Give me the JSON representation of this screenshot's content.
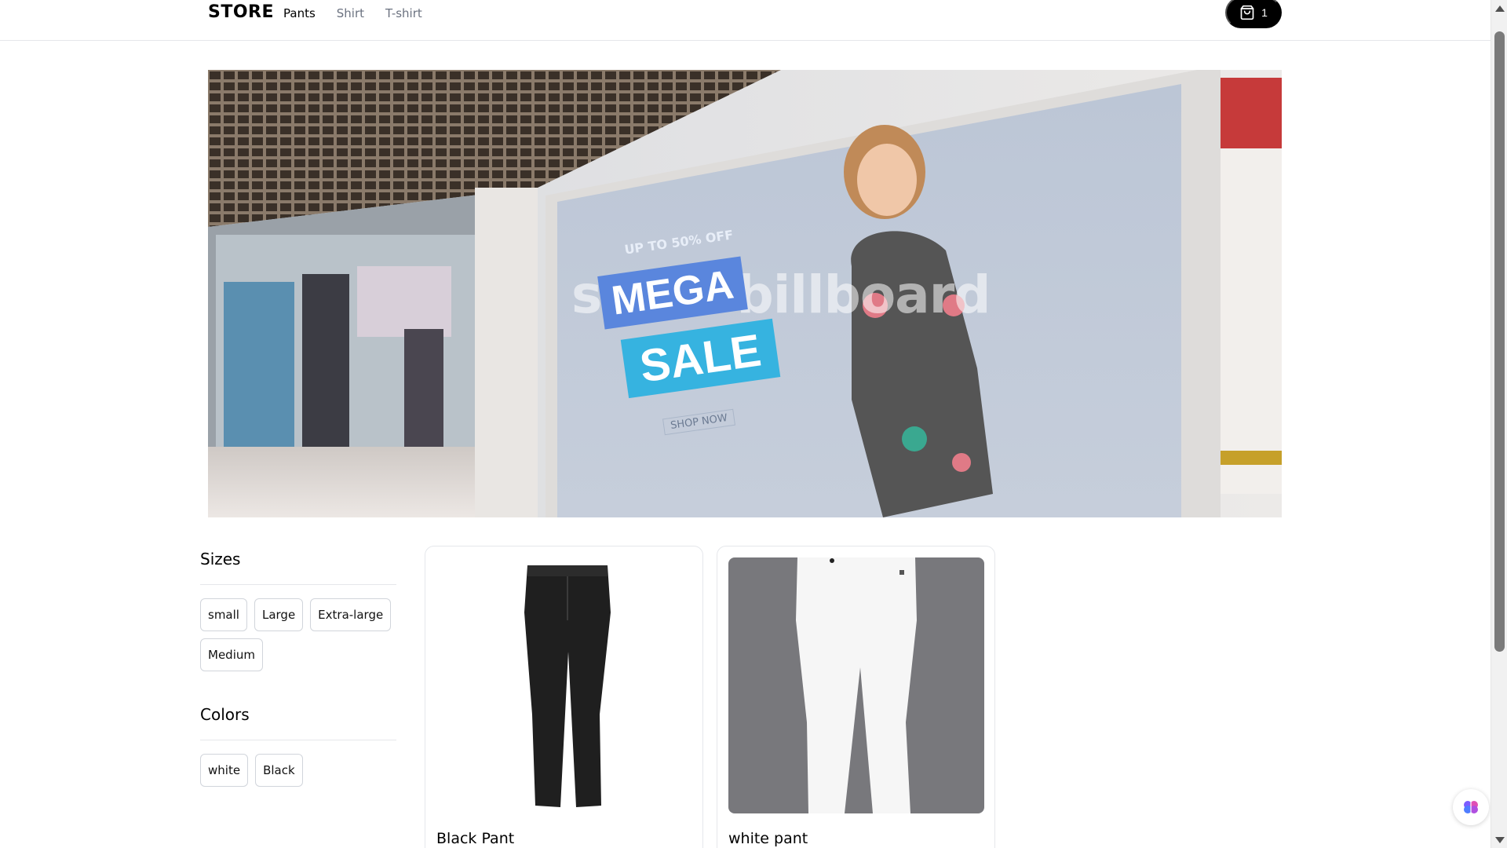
{
  "header": {
    "brand": "STORE",
    "nav": [
      {
        "label": "Pants",
        "active": true
      },
      {
        "label": "Shirt",
        "active": false
      },
      {
        "label": "T-shirt",
        "active": false
      }
    ],
    "cart_count": "1",
    "cart_icon": "shopping-bag-icon"
  },
  "billboard": {
    "label": "store billboard",
    "promo": {
      "small": "UP TO 50% OFF",
      "mega": "MEGA",
      "sale": "SALE",
      "shop": "SHOP NOW"
    }
  },
  "filters": {
    "sizes": {
      "title": "Sizes",
      "options": [
        "small",
        "Large",
        "Extra-large",
        "Medium"
      ]
    },
    "colors": {
      "title": "Colors",
      "options": [
        "white",
        "Black"
      ]
    }
  },
  "products": [
    {
      "name": "Black Pant",
      "image": "black-pants"
    },
    {
      "name": "white pant",
      "image": "white-pants"
    }
  ],
  "colors": {
    "accent": "#000000",
    "border": "#e5e7eb",
    "muted_text": "#6b7280"
  }
}
